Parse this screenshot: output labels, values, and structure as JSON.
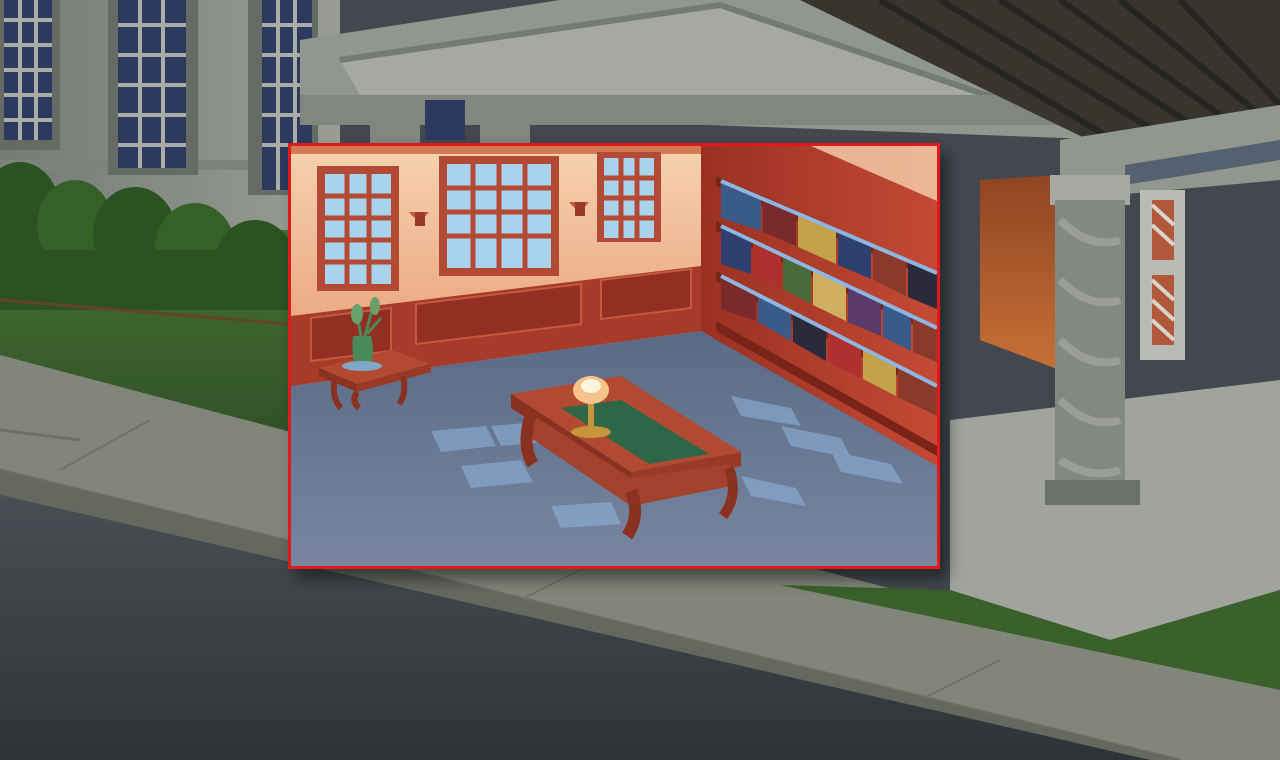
{
  "scene": {
    "location": "street-outside-library",
    "background": {
      "sky_color": "#4a4f55",
      "building_color": "#9ea39b",
      "window_glass_color": "#2f3f66",
      "lawn_color": "#3f6a2e",
      "sidewalk_color": "#8e9186",
      "road_color": "#3b3f44",
      "roof_color": "#3d3a33",
      "interior_glow": "#c0622d"
    }
  },
  "close_up": {
    "room": "library-reading-room",
    "frame_color": "#e01a1a",
    "hotspots": [
      {
        "name": "windows",
        "icon": "window-icon"
      },
      {
        "name": "wall-sconce",
        "icon": "sconce-icon"
      },
      {
        "name": "bookshelf",
        "icon": "bookshelf-icon"
      },
      {
        "name": "reading-table",
        "icon": "table-icon"
      },
      {
        "name": "desk-lamp",
        "icon": "lamp-icon"
      },
      {
        "name": "side-table",
        "icon": "side-table-icon"
      },
      {
        "name": "plant-vase",
        "icon": "vase-icon"
      }
    ],
    "colors": {
      "wall_upper": "#f3c39d",
      "wainscot": "#a83a2a",
      "wood": "#b14a30",
      "floor": "#5f6f8a",
      "window_light": "#a9d2ec",
      "book_spines": [
        "#3a5a8a",
        "#c4a24a",
        "#7a2a2a",
        "#2f3f6f",
        "#8a3a2a",
        "#4a6a3a",
        "#d0b060",
        "#5a3a6a",
        "#b03030",
        "#2a2a3a"
      ]
    }
  }
}
